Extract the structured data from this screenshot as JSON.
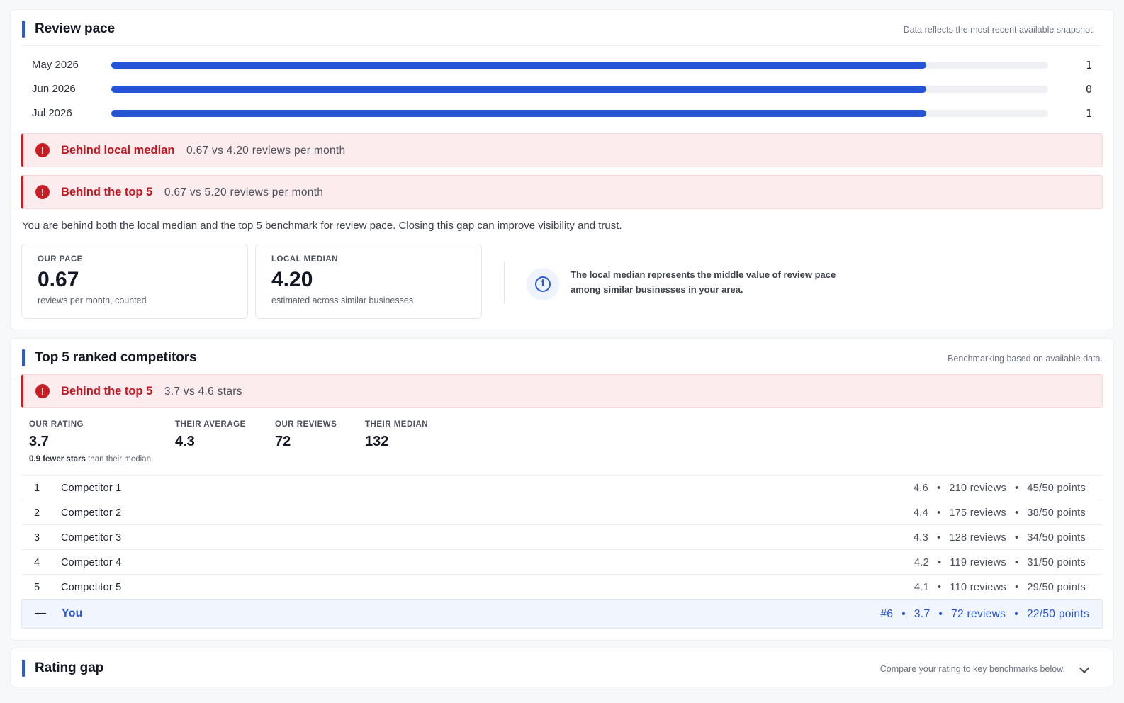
{
  "review_pace": {
    "title": "Review pace",
    "note": "Data reflects the most recent available snapshot.",
    "rows": [
      {
        "label": "May 2026",
        "value": "1",
        "fill": 0.87
      },
      {
        "label": "Jun 2026",
        "value": "0",
        "fill": 0.87
      },
      {
        "label": "Jul 2026",
        "value": "1",
        "fill": 0.87
      }
    ],
    "alerts": [
      {
        "icon": "!",
        "title": "Behind local median",
        "detail": "0.67 vs 4.20 reviews per month"
      },
      {
        "icon": "!",
        "title": "Behind the top 5",
        "detail": "0.67 vs 5.20 reviews per month"
      }
    ],
    "summary": "You are behind both the local median and the top 5 benchmark for review pace. Closing this gap can improve visibility and trust.",
    "our_pace": {
      "label": "OUR PACE",
      "value": "0.67",
      "sub": "reviews per month, counted"
    },
    "local_median": {
      "label": "LOCAL MEDIAN",
      "value": "4.20",
      "sub": "estimated across similar businesses"
    },
    "info": {
      "icon": "i",
      "line1": "The local median represents the middle value of review pace",
      "line2": "among similar businesses in your area."
    }
  },
  "competitors": {
    "title": "Top 5 ranked competitors",
    "note": "Benchmarking based on available data.",
    "alert": {
      "icon": "!",
      "title": "Behind the top 5",
      "detail": "3.7 vs 4.6 stars"
    },
    "metrics": [
      {
        "label": "OUR RATING",
        "value": "3.7"
      },
      {
        "label": "THEIR AVERAGE",
        "value": "4.3"
      },
      {
        "label": "OUR REVIEWS",
        "value": "72"
      },
      {
        "label": "THEIR MEDIAN",
        "value": "132"
      }
    ],
    "metric_sub_bold": "0.9 fewer stars",
    "metric_sub_rest": " than their median.",
    "dot": "•",
    "rows": [
      {
        "rank": "1",
        "name": "Competitor 1",
        "rating": "4.6",
        "reviews": "210 reviews",
        "points": "45/50 points"
      },
      {
        "rank": "2",
        "name": "Competitor 2",
        "rating": "4.4",
        "reviews": "175 reviews",
        "points": "38/50 points"
      },
      {
        "rank": "3",
        "name": "Competitor 3",
        "rating": "4.3",
        "reviews": "128 reviews",
        "points": "34/50 points"
      },
      {
        "rank": "4",
        "name": "Competitor 4",
        "rating": "4.2",
        "reviews": "119 reviews",
        "points": "31/50 points"
      },
      {
        "rank": "5",
        "name": "Competitor 5",
        "rating": "4.1",
        "reviews": "110 reviews",
        "points": "29/50 points"
      }
    ],
    "you": {
      "rank": "—",
      "name": "You",
      "position": "#6",
      "rating": "3.7",
      "reviews": "72 reviews",
      "points": "22/50 points"
    }
  },
  "rating_gap": {
    "title": "Rating gap",
    "note": "Compare your rating to key benchmarks below.",
    "chevron_icon": "chevron-down-icon"
  },
  "colors": {
    "accent": "#2555d6",
    "danger": "#c91d23",
    "alert_bg": "#fdecee"
  }
}
